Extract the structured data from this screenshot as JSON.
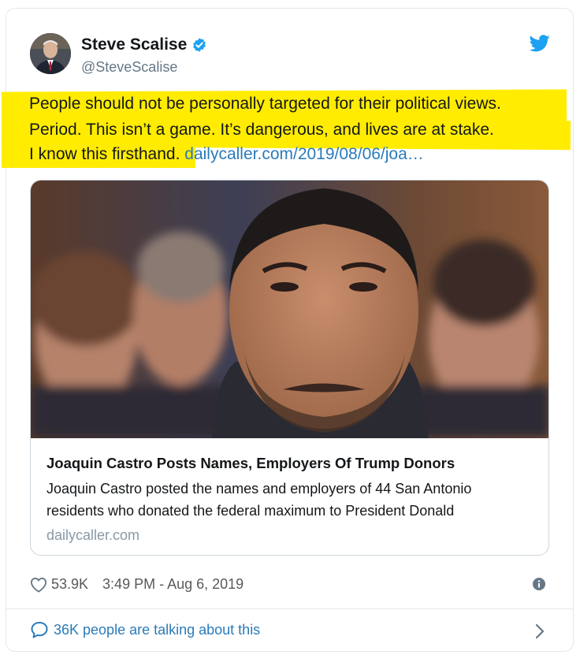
{
  "author": {
    "name": "Steve Scalise",
    "handle": "@SteveScalise"
  },
  "tweet": {
    "lines": [
      "People should not be personally targeted for their political views.",
      "Period. This isn’t a game. It’s dangerous, and lives are at stake.",
      "I know this firsthand."
    ],
    "link": "dailycaller.com/2019/08/06/joa…"
  },
  "card": {
    "title": "Joaquin Castro Posts Names, Employers Of Trump Donors",
    "description_lines": [
      "Joaquin Castro posted the names and employers of 44 San Antonio",
      "residents who donated the federal maximum to President Donald"
    ],
    "domain": "dailycaller.com"
  },
  "meta": {
    "likes": "53.9K",
    "timestamp": "3:49 PM - Aug 6, 2019"
  },
  "footer": {
    "talking": "36K people are talking about this"
  },
  "colors": {
    "highlight": "#ffec00",
    "link": "#2b7bb9",
    "twitter_blue": "#1da1f2"
  },
  "icons": [
    "verified-badge-icon",
    "twitter-bird-icon",
    "heart-icon",
    "info-icon",
    "speech-bubble-icon",
    "chevron-right-icon"
  ]
}
